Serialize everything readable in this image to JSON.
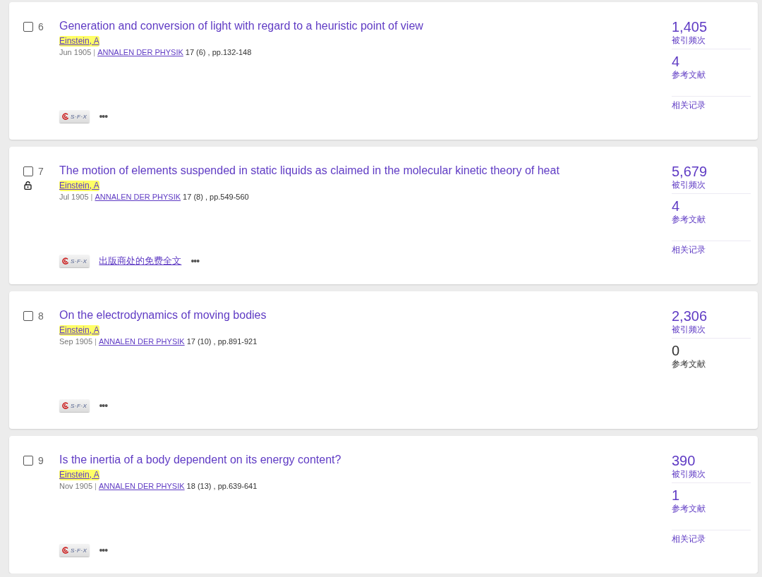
{
  "records": [
    {
      "checked": false,
      "number": "6",
      "open_access": false,
      "title": "Generation and conversion of light with regard to a heuristic point of view",
      "author": "Einstein, A",
      "date": "Jun 1905",
      "separator": "|",
      "journal": "ANNALEN DER PHYSIK",
      "details": "17 (6) , pp.132-148",
      "sfx_label": "S·F·X",
      "more": "•••",
      "metrics": [
        {
          "value": "1,405",
          "label": "被引频次",
          "kind": "link"
        },
        {
          "value": "4",
          "label": "参考文献",
          "kind": "link"
        }
      ],
      "related": "相关记录"
    },
    {
      "checked": false,
      "number": "7",
      "open_access": true,
      "title": "The motion of elements suspended in static liquids as claimed in the molecular kinetic theory of heat",
      "author": "Einstein, A",
      "date": "Jul 1905",
      "separator": "|",
      "journal": "ANNALEN DER PHYSIK",
      "details": "17 (8) , pp.549-560",
      "sfx_label": "S·F·X",
      "free_fulltext": "出版商处的免费全文",
      "more": "•••",
      "metrics": [
        {
          "value": "5,679",
          "label": "被引频次",
          "kind": "link"
        },
        {
          "value": "4",
          "label": "参考文献",
          "kind": "link"
        }
      ],
      "related": "相关记录"
    },
    {
      "checked": false,
      "number": "8",
      "open_access": false,
      "title": "On the electrodynamics of moving bodies",
      "author": "Einstein, A",
      "date": "Sep 1905",
      "separator": "|",
      "journal": "ANNALEN DER PHYSIK",
      "details": "17 (10) , pp.891-921",
      "sfx_label": "S·F·X",
      "more": "•••",
      "metrics": [
        {
          "value": "2,306",
          "label": "被引频次",
          "kind": "link"
        },
        {
          "value": "0",
          "label": "参考文献",
          "kind": "plain"
        }
      ]
    },
    {
      "checked": false,
      "number": "9",
      "open_access": false,
      "title": "Is the inertia of a body dependent on its energy content?",
      "author": "Einstein, A",
      "date": "Nov 1905",
      "separator": "|",
      "journal": "ANNALEN DER PHYSIK",
      "details": "18 (13) , pp.639-641",
      "sfx_label": "S·F·X",
      "more": "•••",
      "metrics": [
        {
          "value": "390",
          "label": "被引频次",
          "kind": "link"
        },
        {
          "value": "1",
          "label": "参考文献",
          "kind": "link"
        }
      ],
      "related": "相关记录"
    }
  ]
}
